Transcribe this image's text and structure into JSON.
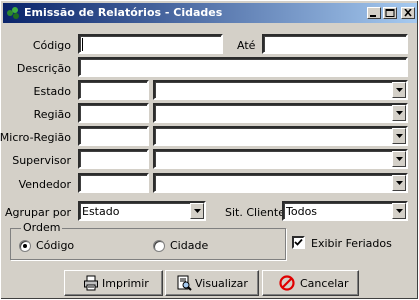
{
  "window": {
    "title": "Emissão de Relatórios - Cidades",
    "buttons": [
      "minimize-icon",
      "maximize-icon",
      "close-icon"
    ]
  },
  "form": {
    "codigo_label": "Código",
    "codigo_value": "",
    "ate_label": "Até",
    "ate_value": "",
    "descricao_label": "Descrição",
    "descricao_value": "",
    "estado_label": "Estado",
    "regiao_label": "Região",
    "microregiao_label": "Micro-Região",
    "supervisor_label": "Supervisor",
    "vendedor_label": "Vendedor",
    "agrupar_label": "Agrupar por",
    "agrupar_value": "Estado",
    "sitcliente_label": "Sit. Cliente",
    "sitcliente_value": "Todos"
  },
  "ordem": {
    "legend": "Ordem",
    "option_codigo": "Código",
    "option_cidade": "Cidade",
    "selected": "Código"
  },
  "exibir_feriados": {
    "label": "Exibir Feriados",
    "checked": true
  },
  "actions": {
    "imprimir": "Imprimir",
    "visualizar": "Visualizar",
    "cancelar": "Cancelar"
  },
  "colors": {
    "title_start": "#0a246a",
    "title_end": "#a6caf0",
    "face": "#d4d0c8",
    "cancel_red": "#e00000"
  }
}
